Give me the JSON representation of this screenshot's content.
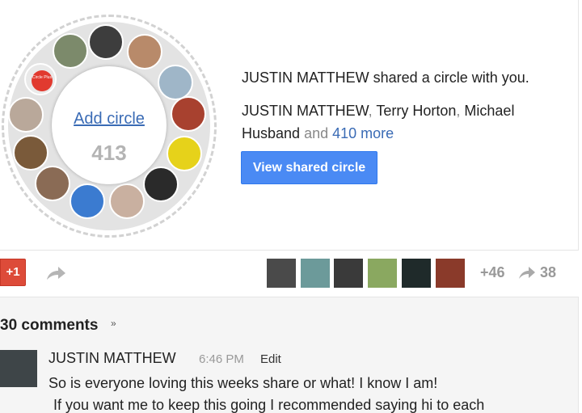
{
  "shared_circle": {
    "add_circle_label": "Add circle",
    "member_count": "413",
    "circle_plus_badge": "Circle Plus",
    "share_line": "JUSTIN MATTHEW shared a circle with you.",
    "people": {
      "name1": "JUSTIN MATTHEW",
      "sep1": ",",
      "name2": "Terry Horton",
      "sep2": ",",
      "name3": "Michael Husband",
      "and_text": "and",
      "more_link": "410 more"
    },
    "view_button": "View shared circle",
    "avatars": [
      {
        "name": "circle-plus-avatar",
        "color": "#e13a2f"
      },
      {
        "name": "avatar-man-tree",
        "color": "#7c8a6b"
      },
      {
        "name": "avatar-man-sunglasses",
        "color": "#3d3d3d"
      },
      {
        "name": "avatar-bald-man",
        "color": "#b88a6a"
      },
      {
        "name": "avatar-man-sky",
        "color": "#9fb6c8"
      },
      {
        "name": "avatar-red-face",
        "color": "#a8412f"
      },
      {
        "name": "avatar-yellow-face",
        "color": "#e6d21a"
      },
      {
        "name": "avatar-dark-hair",
        "color": "#2a2a2a"
      },
      {
        "name": "avatar-old-man",
        "color": "#c9b0a0"
      },
      {
        "name": "avatar-blue-art",
        "color": "#3b7bd0"
      },
      {
        "name": "avatar-woman-glasses",
        "color": "#8a6b55"
      },
      {
        "name": "avatar-man-colorful",
        "color": "#7a5a3a"
      },
      {
        "name": "avatar-woman-portrait",
        "color": "#b9a89a"
      }
    ]
  },
  "actions": {
    "plus_one": "+1",
    "plus_count": "+46",
    "reshare_count": "38",
    "sharers": [
      {
        "color": "#4a4a4a"
      },
      {
        "color": "#6c9a9a"
      },
      {
        "color": "#3a3a3a"
      },
      {
        "color": "#8aa860"
      },
      {
        "color": "#1f2a2a"
      },
      {
        "color": "#8a3a2a"
      }
    ]
  },
  "comments": {
    "count_label": "30 comments",
    "first": {
      "author": "JUSTIN MATTHEW",
      "time": "6:46 PM",
      "edit": "Edit",
      "line1": "So is everyone loving this weeks share or what! I know I am!",
      "line2": "If you want me to keep this going I recommended saying hi to each"
    }
  },
  "colors": {
    "accent_blue": "#4a8af4",
    "plus_one_red": "#dd4b39",
    "link_blue": "#3a6bb5"
  }
}
